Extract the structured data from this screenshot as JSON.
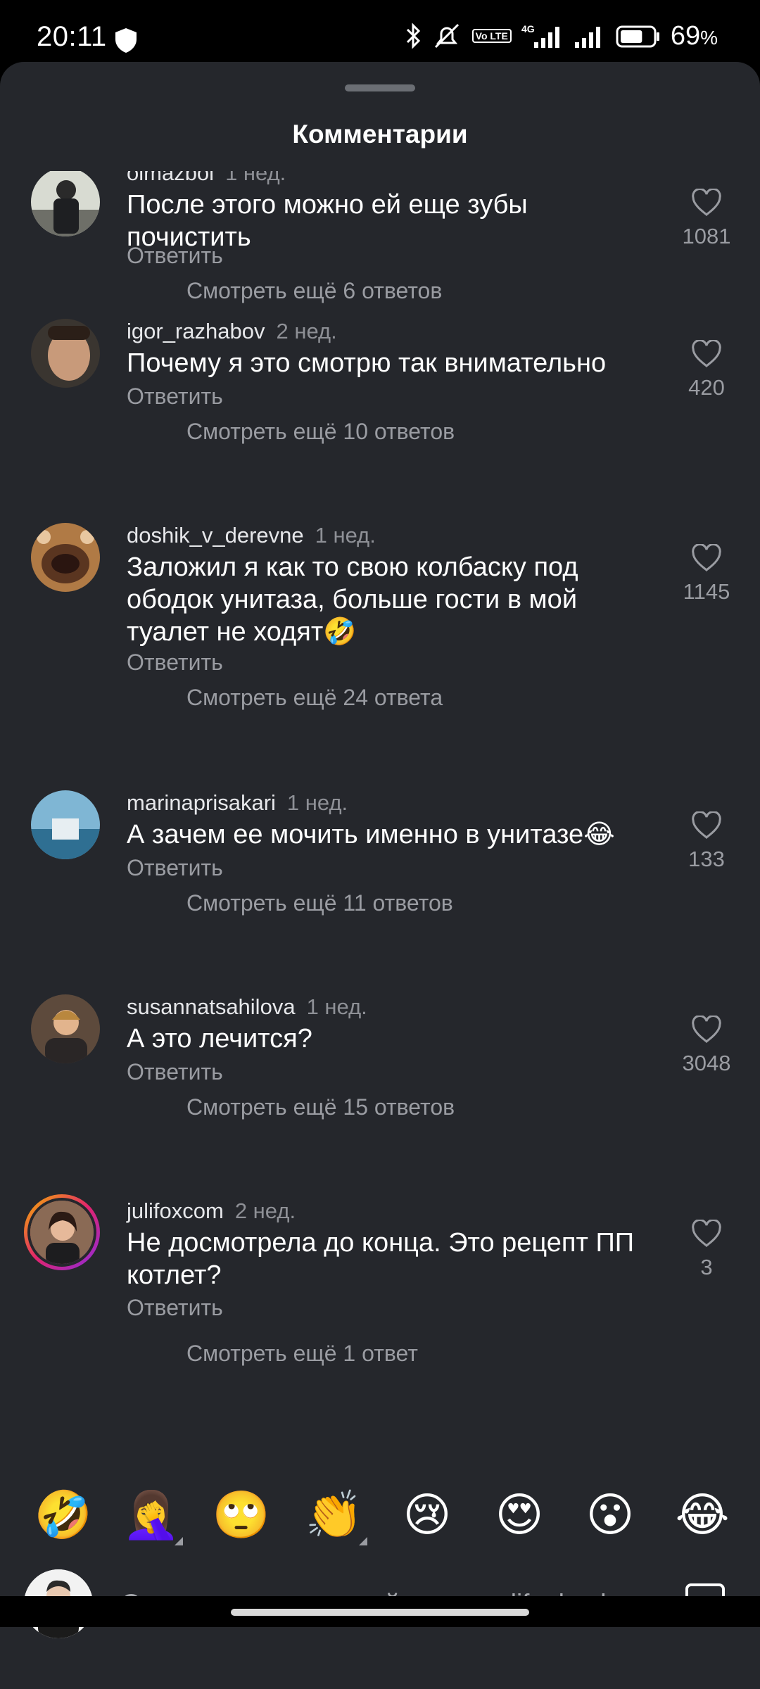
{
  "status_bar": {
    "time": "20:11",
    "network": "4G",
    "volte": "Vo LTE",
    "battery_percent": "69",
    "battery_unit": "%",
    "battery_level": 0.69
  },
  "sheet": {
    "title": "Комментарии"
  },
  "comments": [
    {
      "username": "olmazbol",
      "date": "1 нед.",
      "text": "После этого можно ей еще зубы почистить",
      "reply_label": "Ответить",
      "likes": "1081",
      "more_replies": "Смотреть ещё 6 ответов"
    },
    {
      "username": "igor_razhabov",
      "date": "2 нед.",
      "text": "Почему я это смотрю так внимательно",
      "reply_label": "Ответить",
      "likes": "420",
      "more_replies": "Смотреть ещё 10 ответов"
    },
    {
      "username": "doshik_v_derevne",
      "date": "1 нед.",
      "text": "Заложил я как то свою колбаску под ободок унитаза, больше гости в мой туалет не ходят🤣",
      "reply_label": "Ответить",
      "likes": "1145",
      "more_replies": "Смотреть ещё 24 ответа"
    },
    {
      "username": "marinaprisakari",
      "date": "1 нед.",
      "text": "А зачем ее мочить именно в унитазе😂",
      "reply_label": "Ответить",
      "likes": "133",
      "more_replies": "Смотреть ещё 11 ответов"
    },
    {
      "username": "susannatsahilova",
      "date": "1 нед.",
      "text": "А это лечится?",
      "reply_label": "Ответить",
      "likes": "3048",
      "more_replies": "Смотреть ещё 15 ответов"
    },
    {
      "username": "julifoxcom",
      "date": "2 нед.",
      "text": "Не досмотрела до конца. Это рецепт ПП котлет?",
      "reply_label": "Ответить",
      "likes": "3",
      "more_replies": "Смотреть ещё 1 ответ"
    }
  ],
  "emoji_bar": [
    "🤣",
    "🤦‍♀️",
    "🙄",
    "👏",
    "😢",
    "😍",
    "😮",
    "😂"
  ],
  "composer": {
    "placeholder": "Оставьте комментарий для pro_life_hack_"
  },
  "icons": {
    "heart": "heart-icon",
    "sticker": "sticker-icon",
    "shield": "shield-icon",
    "bluetooth": "bluetooth-icon"
  },
  "colors": {
    "sheet_bg": "#25272c",
    "muted_text": "#9a9ca2",
    "accent_ring": "#e2246c"
  }
}
